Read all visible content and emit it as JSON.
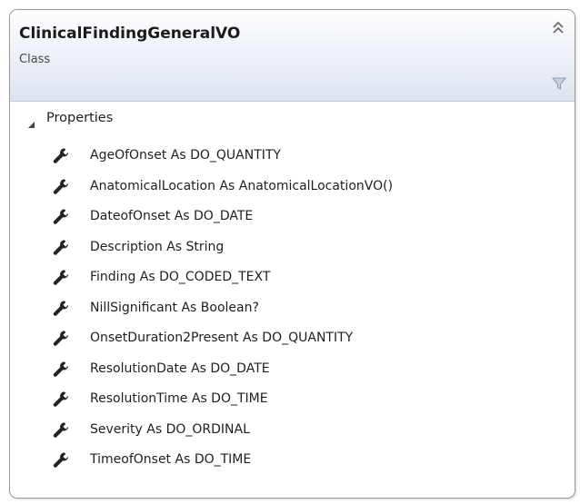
{
  "class_shape": {
    "name": "ClinicalFindingGeneralVO",
    "kind": "Class"
  },
  "icons": {
    "collapse": "double-chevron-up-icon",
    "filter": "filter-icon",
    "expander": "expanded-triangle-icon",
    "property": "wrench-icon"
  },
  "sections": [
    {
      "title": "Properties",
      "items": [
        {
          "label": "AgeOfOnset As DO_QUANTITY"
        },
        {
          "label": "AnatomicalLocation As AnatomicalLocationVO()"
        },
        {
          "label": "DateofOnset As DO_DATE"
        },
        {
          "label": "Description As String"
        },
        {
          "label": "Finding As DO_CODED_TEXT"
        },
        {
          "label": "NillSignificant As Boolean?"
        },
        {
          "label": "OnsetDuration2Present As DO_QUANTITY"
        },
        {
          "label": "ResolutionDate As DO_DATE"
        },
        {
          "label": "ResolutionTime As DO_TIME"
        },
        {
          "label": "Severity As DO_ORDINAL"
        },
        {
          "label": "TimeofOnset As DO_TIME"
        }
      ]
    }
  ],
  "colors": {
    "header_gradient_bottom": "#dde4ef",
    "border": "#9a9a9a",
    "icon": "#222222",
    "filter_icon": "#8a9ab0"
  }
}
